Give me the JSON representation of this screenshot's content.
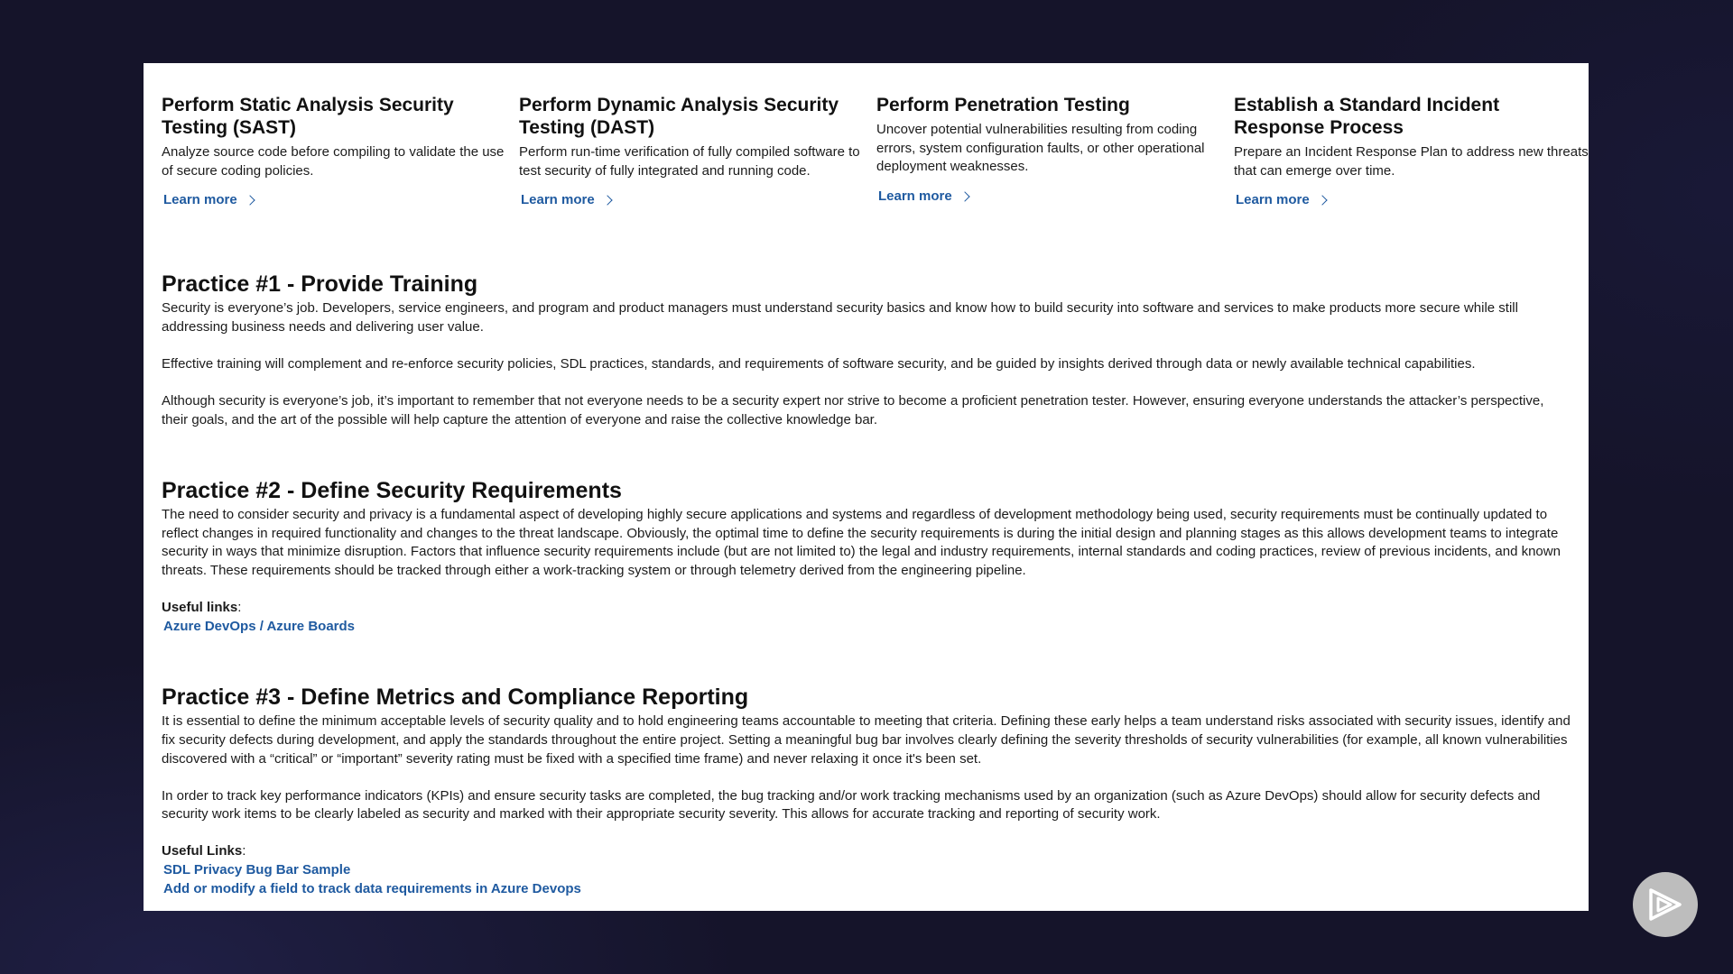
{
  "cards": [
    {
      "title": "Perform Static Analysis Security Testing (SAST)",
      "description": "Analyze source code before compiling to validate the use of secure coding policies.",
      "link": "Learn more"
    },
    {
      "title": "Perform Dynamic Analysis Security Testing (DAST)",
      "description": "Perform run-time verification of fully compiled software to test security of fully integrated and running code.",
      "link": "Learn more"
    },
    {
      "title": "Perform Penetration Testing",
      "description": "Uncover potential vulnerabilities resulting from coding errors, system configuration faults, or other operational deployment weaknesses.",
      "link": "Learn more"
    },
    {
      "title": "Establish a Standard Incident Response Process",
      "description": "Prepare an Incident Response Plan to address new threats that can emerge over time.",
      "link": "Learn more"
    }
  ],
  "practice1": {
    "title": "Practice #1 - Provide Training",
    "paragraphs": [
      "Security is everyone’s job. Developers, service engineers, and program and product managers must understand security basics and know how to build security into software and services to make products more secure while still addressing business needs and delivering user value.",
      "Effective training will complement and re-enforce security policies, SDL practices, standards, and requirements of software security, and be guided by insights derived through data or newly available technical capabilities.",
      "Although security is everyone’s job, it’s important to remember that not everyone needs to be a security expert nor strive to become a proficient penetration tester. However, ensuring everyone understands the attacker’s perspective, their goals, and the art of the possible will help capture the attention of everyone and raise the collective knowledge bar."
    ]
  },
  "practice2": {
    "title": "Practice #2 - Define Security Requirements",
    "paragraphs": [
      "The need to consider security and privacy is a fundamental aspect of developing highly secure applications and systems and regardless of development methodology being used, security requirements must be continually updated to reflect changes in required functionality and changes to the threat landscape. Obviously, the optimal time to define the security requirements is during the initial design and planning stages as this allows development teams to integrate security in ways that minimize disruption. Factors that influence security requirements include (but are not limited to) the legal and industry requirements, internal standards and coding practices, review of previous incidents, and known threats. These requirements should be tracked through either a work-tracking system or through telemetry derived from the engineering pipeline."
    ],
    "useful_label": "Useful links",
    "links": [
      "Azure DevOps / Azure Boards"
    ]
  },
  "practice3": {
    "title": "Practice #3 - Define Metrics and Compliance Reporting",
    "paragraphs": [
      "It is essential to define the minimum acceptable levels of security quality and to hold engineering teams accountable to meeting that criteria. Defining these early helps a team understand risks associated with security issues, identify and fix security defects during development, and apply the standards throughout the entire project. Setting a meaningful bug bar involves clearly defining the severity thresholds of security vulnerabilities (for example, all known vulnerabilities discovered with a “critical” or “important” severity rating must be fixed with a specified time frame) and never relaxing it once it's been set.",
      "In order to track key performance indicators (KPIs) and ensure security tasks are completed, the bug tracking and/or work tracking mechanisms used by an organization (such as Azure DevOps) should allow for security defects and security work items to be clearly labeled as security and marked with their appropriate security severity. This allows for accurate tracking and reporting of security work."
    ],
    "useful_label": "Useful Links",
    "links": [
      "SDL Privacy Bug Bar Sample",
      "Add or modify a field to track data requirements in Azure Devops"
    ]
  },
  "player": {
    "icon": "play-logo-icon"
  },
  "colors": {
    "link": "#1f5aa0",
    "background": "#15142a",
    "panel": "#ffffff"
  }
}
